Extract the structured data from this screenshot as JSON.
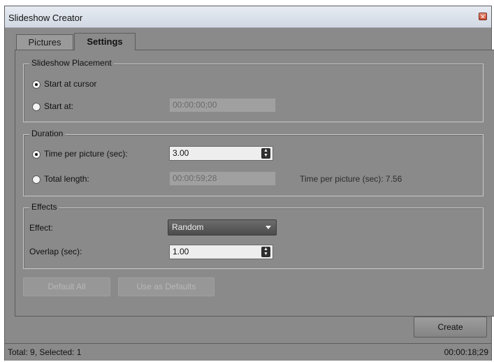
{
  "window": {
    "title": "Slideshow Creator",
    "close_glyph": "✕"
  },
  "tabs": [
    {
      "label": "Pictures",
      "active": false
    },
    {
      "label": "Settings",
      "active": true
    }
  ],
  "placement": {
    "legend": "Slideshow Placement",
    "start_cursor_label": "Start at cursor",
    "start_cursor_checked": true,
    "start_at_label": "Start at:",
    "start_at_value": "00:00:00;00"
  },
  "duration": {
    "legend": "Duration",
    "time_per_picture_label": "Time per picture (sec):",
    "time_per_picture_value": "3.00",
    "total_length_label": "Total length:",
    "total_length_value": "00:00:59;28",
    "computed_text": "Time per picture (sec): 7.56"
  },
  "effects": {
    "legend": "Effects",
    "effect_label": "Effect:",
    "effect_value": "Random",
    "overlap_label": "Overlap (sec):",
    "overlap_value": "1.00"
  },
  "buttons": {
    "default_all": "Default All",
    "use_as_defaults": "Use as Defaults",
    "create": "Create"
  },
  "status": {
    "left": "Total: 9, Selected: 1",
    "right": "00:00:18;29"
  },
  "icons": {
    "spin": "spin-updown-icon",
    "dropdown": "chevron-down-icon",
    "close": "close-icon"
  },
  "colors": {
    "window_bg": "#8a8a8a",
    "titlebar": "#dde3eb",
    "close_button": "#c94a2f"
  }
}
